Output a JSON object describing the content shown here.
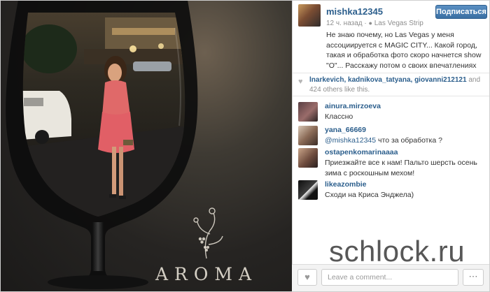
{
  "post": {
    "username": "mishka12345",
    "follow_label": "Подписаться",
    "time": "12 ч. назад",
    "location": "Las Vegas Strip",
    "caption": "Не знаю почему, но Las Vegas у меня ассоциируется с MAGIC CITY... Какой город, такая и обработка фото⁠⁠⁠ скоро начнется show \"O\"... Расскажу потом о своих впечатлениях⁠⁠"
  },
  "likes": {
    "names": "lnarkevich, kadnikova_tatyana, giovanni212121",
    "connector": "and",
    "count": "424",
    "suffix": "others like this."
  },
  "comments": [
    {
      "username": "ainura.mirzoeva",
      "text": "Классно"
    },
    {
      "username": "yana_66669",
      "mention": "@mishka12345",
      "text": " что за обработка ?"
    },
    {
      "username": "ostapenkomarinaaaa",
      "text": "Приезжайте все к нам! Пальто шерсть осень зима с роскошным мехом!"
    },
    {
      "username": "likeazombie",
      "text": "Сходи на Криса Энджела)"
    }
  ],
  "footer": {
    "comment_placeholder": "Leave a comment...",
    "like_icon": "heart-icon",
    "more_icon": "ellipsis-icon"
  },
  "watermarks": {
    "logo_text": "AROMA",
    "site": "schlock.ru"
  },
  "colors": {
    "link_blue": "#2b5e8c",
    "follow_button": "#3a6fa3"
  }
}
